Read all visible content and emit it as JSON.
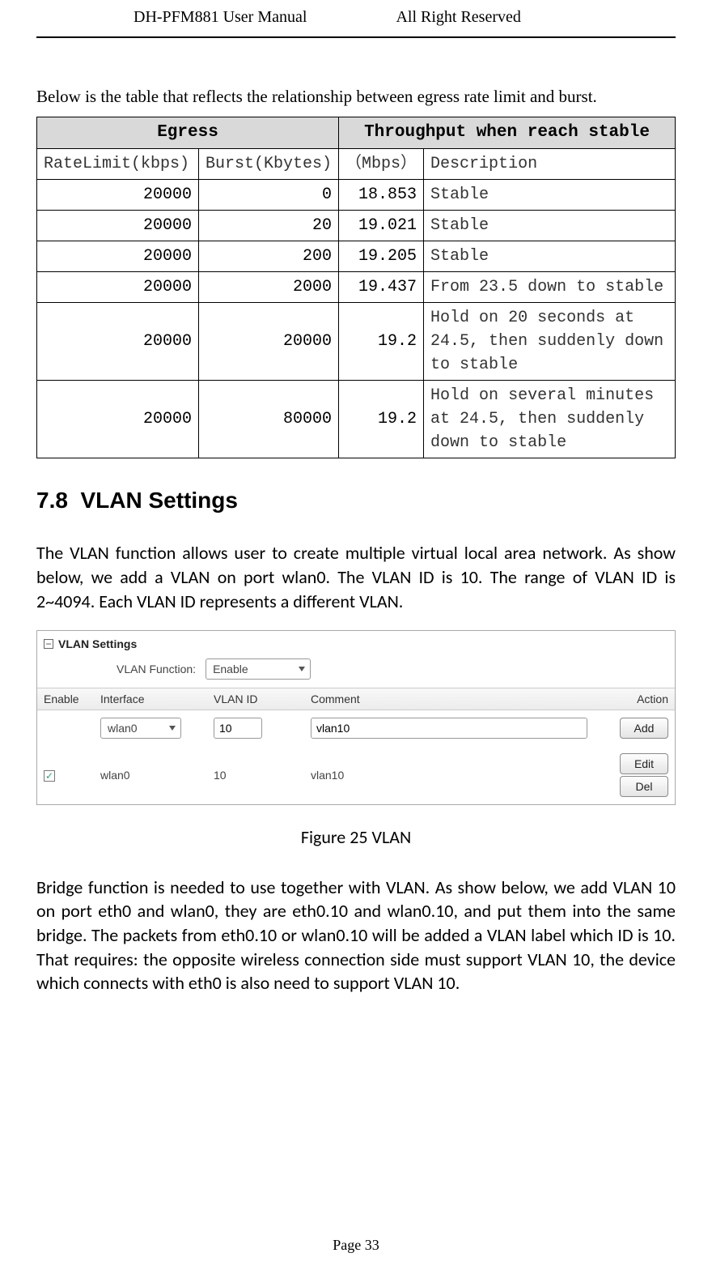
{
  "header": {
    "left": "DH-PFM881 User Manual",
    "right": "All Right Reserved"
  },
  "intro": "Below is the table that reflects the relationship between egress rate limit and burst.",
  "table": {
    "group_headers": [
      "Egress",
      "Throughput when reach stable"
    ],
    "sub_headers": [
      "RateLimit(kbps)",
      "Burst(Kbytes)",
      "（Mbps）",
      "Description"
    ],
    "rows": [
      {
        "rate": "20000",
        "burst": "0",
        "mbps": "18.853",
        "desc": "Stable"
      },
      {
        "rate": "20000",
        "burst": "20",
        "mbps": "19.021",
        "desc": "Stable"
      },
      {
        "rate": "20000",
        "burst": "200",
        "mbps": "19.205",
        "desc": "Stable"
      },
      {
        "rate": "20000",
        "burst": "2000",
        "mbps": "19.437",
        "desc": "From 23.5 down to stable"
      },
      {
        "rate": "20000",
        "burst": "20000",
        "mbps": "19.2",
        "desc": "Hold on 20 seconds at 24.5, then suddenly down to stable"
      },
      {
        "rate": "20000",
        "burst": "80000",
        "mbps": "19.2",
        "desc": "Hold on several minutes at 24.5, then suddenly down to stable"
      }
    ]
  },
  "chart_data": {
    "type": "table",
    "title": "Egress rate limit vs throughput",
    "columns": [
      "RateLimit(kbps)",
      "Burst(Kbytes)",
      "(Mbps)",
      "Description"
    ],
    "rows": [
      [
        "20000",
        "0",
        "18.853",
        "Stable"
      ],
      [
        "20000",
        "20",
        "19.021",
        "Stable"
      ],
      [
        "20000",
        "200",
        "19.205",
        "Stable"
      ],
      [
        "20000",
        "2000",
        "19.437",
        "From 23.5 down to stable"
      ],
      [
        "20000",
        "20000",
        "19.2",
        "Hold on 20 seconds at 24.5, then suddenly down to stable"
      ],
      [
        "20000",
        "80000",
        "19.2",
        "Hold on several minutes at 24.5, then suddenly down to stable"
      ]
    ]
  },
  "section": {
    "number": "7.8",
    "title": "VLAN Settings"
  },
  "para1": "The VLAN function allows user to create multiple virtual local area network. As show below, we add a VLAN on port wlan0. The VLAN ID is 10. The range of VLAN ID is 2~4094. Each VLAN ID represents a different VLAN.",
  "vlan": {
    "panel_title": "VLAN Settings",
    "func_label": "VLAN Function:",
    "func_value": "Enable",
    "headers": {
      "enable": "Enable",
      "interface": "Interface",
      "vlanid": "VLAN ID",
      "comment": "Comment",
      "action": "Action"
    },
    "input_row": {
      "interface": "wlan0",
      "vlanid": "10",
      "comment": "vlan10",
      "add_label": "Add"
    },
    "data_row": {
      "checked": "✓",
      "interface": "wlan0",
      "vlanid": "10",
      "comment": "vlan10",
      "edit_label": "Edit",
      "del_label": "Del"
    }
  },
  "figure_caption": "Figure 25 VLAN",
  "para2": "Bridge function is needed to use together with VLAN. As show below, we add VLAN 10 on port eth0 and wlan0, they are eth0.10 and wlan0.10, and put them into the same bridge. The packets from eth0.10 or wlan0.10 will be added a VLAN label which ID is 10. That requires: the opposite wireless connection side must support VLAN 10, the device which connects with eth0 is also need to support VLAN 10.",
  "page_number": "Page 33"
}
